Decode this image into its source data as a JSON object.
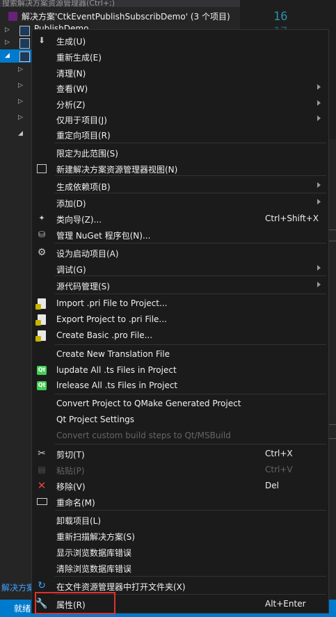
{
  "background": {
    "search_placeholder": "搜索解决方案资源管理器(Ctrl+;)",
    "solution_label": "解决方案'CtkEventPublishSubscribDemo' (3 个项目)",
    "line_numbers": [
      "16",
      "17"
    ],
    "partial_project_label": "PublishDemo",
    "bottom_link": "解决方案",
    "status": "就绪"
  },
  "menu": {
    "items": [
      {
        "label": "生成(U)",
        "icon": "build-icon"
      },
      {
        "label": "重新生成(E)"
      },
      {
        "label": "清理(N)"
      },
      {
        "label": "查看(W)",
        "submenu": true
      },
      {
        "label": "分析(Z)",
        "submenu": true
      },
      {
        "label": "仅用于项目(J)",
        "submenu": true
      },
      {
        "label": "重定向项目(R)"
      },
      {
        "label": "限定为此范围(S)"
      },
      {
        "label": "新建解决方案资源管理器视图(N)",
        "icon": "new-view-icon"
      },
      {
        "label": "生成依赖项(B)",
        "submenu": true
      },
      {
        "label": "添加(D)",
        "submenu": true
      },
      {
        "label": "类向导(Z)...",
        "shortcut": "Ctrl+Shift+X",
        "icon": "class-wizard-icon"
      },
      {
        "label": "管理 NuGet 程序包(N)...",
        "icon": "nuget-icon"
      },
      {
        "label": "设为启动项目(A)",
        "icon": "gear-icon"
      },
      {
        "label": "调试(G)",
        "submenu": true
      },
      {
        "label": "源代码管理(S)",
        "submenu": true
      },
      {
        "label": "Import .pri File to Project...",
        "icon": "pri-file-icon"
      },
      {
        "label": "Export Project to .pri File...",
        "icon": "pri-file-icon"
      },
      {
        "label": "Create Basic .pro File...",
        "icon": "pro-file-icon"
      },
      {
        "label": "Create New Translation File"
      },
      {
        "label": "lupdate All .ts Files in Project",
        "icon": "qt-icon"
      },
      {
        "label": "lrelease All .ts Files in Project",
        "icon": "qt-icon"
      },
      {
        "label": "Convert Project to QMake Generated Project"
      },
      {
        "label": "Qt Project Settings"
      },
      {
        "label": "Convert custom build steps to Qt/MSBuild",
        "disabled": true
      },
      {
        "label": "剪切(T)",
        "shortcut": "Ctrl+X",
        "icon": "scissors-icon"
      },
      {
        "label": "粘贴(P)",
        "shortcut": "Ctrl+V",
        "disabled": true,
        "icon": "paste-icon"
      },
      {
        "label": "移除(V)",
        "shortcut": "Del",
        "icon": "remove-icon"
      },
      {
        "label": "重命名(M)",
        "icon": "rename-icon"
      },
      {
        "label": "卸载项目(L)"
      },
      {
        "label": "重新扫描解决方案(S)"
      },
      {
        "label": "显示浏览数据库错误"
      },
      {
        "label": "清除浏览数据库错误"
      },
      {
        "label": "在文件资源管理器中打开文件夹(X)",
        "icon": "open-folder-icon"
      },
      {
        "label": "属性(R)",
        "shortcut": "Alt+Enter",
        "icon": "wrench-icon"
      }
    ]
  }
}
